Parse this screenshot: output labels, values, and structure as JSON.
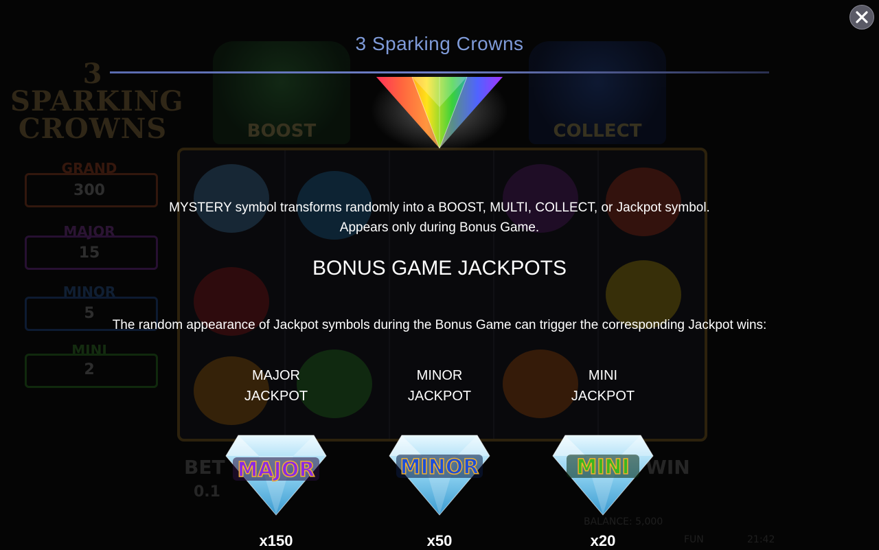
{
  "header": {
    "title": "3 Sparking Crowns",
    "close_icon": "close-icon"
  },
  "mystery": {
    "description": "MYSTERY symbol transforms randomly into a BOOST, MULTI, COLLECT, or Jackpot symbol.",
    "note": "Appears only during Bonus Game."
  },
  "jackpots_section": {
    "heading": "BONUS GAME JACKPOTS",
    "description": "The random appearance of Jackpot symbols during the Bonus Game can trigger the corresponding Jackpot wins:",
    "items": [
      {
        "line1": "MAJOR",
        "line2": "JACKPOT",
        "badge": "MAJOR",
        "multiplier": "x150",
        "badge_color": "#8a2be2"
      },
      {
        "line1": "MINOR",
        "line2": "JACKPOT",
        "badge": "MINOR",
        "multiplier": "x50",
        "badge_color": "#1f4fd6"
      },
      {
        "line1": "MINI",
        "line2": "JACKPOT",
        "badge": "MINI",
        "multiplier": "x20",
        "badge_color": "#3cb521"
      }
    ]
  },
  "background_game": {
    "logo": "3 SPARKING CROWNS",
    "boost_label": "BOOST",
    "collect_label": "COLLECT",
    "side_panels": [
      {
        "label": "GRAND",
        "value": "300"
      },
      {
        "label": "MAJOR",
        "value": "15"
      },
      {
        "label": "MINOR",
        "value": "5"
      },
      {
        "label": "MINI",
        "value": "2"
      }
    ],
    "bet_label": "BET",
    "bet_value": "0.1",
    "win_label": "WIN",
    "balance": "BALANCE: 5,000",
    "mode": "FUN",
    "clock": "21:42"
  },
  "colors": {
    "title": "#7f9bd9",
    "accent_rule": "#6f7fc7",
    "major": "#8a2be2",
    "minor": "#1f4fd6",
    "mini": "#3cb521"
  }
}
